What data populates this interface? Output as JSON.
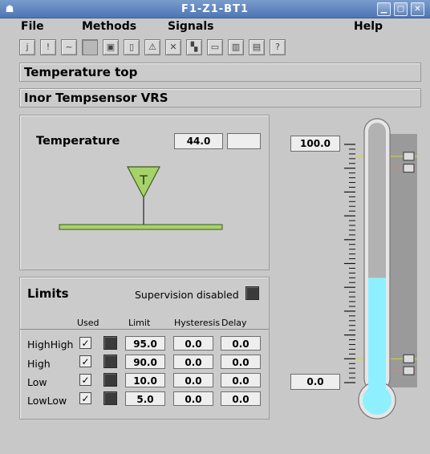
{
  "window": {
    "title": "F1-Z1-BT1"
  },
  "menu": {
    "file": "File",
    "methods": "Methods",
    "signals": "Signals",
    "help": "Help"
  },
  "toolbar": {
    "items": [
      "j",
      "!",
      "~",
      "",
      "▣",
      "▯",
      "⚠",
      "✕",
      "▚",
      "▭",
      "▥",
      "▤",
      "?"
    ]
  },
  "header": {
    "title": "Temperature top",
    "subtitle": "Inor Tempsensor VRS"
  },
  "sensor": {
    "label": "Temperature",
    "value": "44.0",
    "unit": "",
    "symbol": "T"
  },
  "limits": {
    "title": "Limits",
    "supervision": "Supervision disabled",
    "col_used": "Used",
    "col_limit": "Limit",
    "col_hysteresis": "Hysteresis",
    "col_delay": "Delay",
    "rows": [
      {
        "name": "HighHigh",
        "limit": "95.0",
        "hyst": "0.0",
        "delay": "0.0",
        "used": "✓"
      },
      {
        "name": "High",
        "limit": "90.0",
        "hyst": "0.0",
        "delay": "0.0",
        "used": "✓"
      },
      {
        "name": "Low",
        "limit": "10.0",
        "hyst": "0.0",
        "delay": "0.0",
        "used": "✓"
      },
      {
        "name": "LowLow",
        "limit": "5.0",
        "hyst": "0.0",
        "delay": "0.0",
        "used": "✓"
      }
    ]
  },
  "gauge": {
    "max_label": "100.0",
    "min_label": "0.0",
    "min": 0,
    "max": 100,
    "value": 44.0,
    "fill_color": "#8ef0ff"
  }
}
